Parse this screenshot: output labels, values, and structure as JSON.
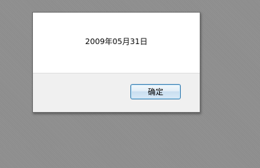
{
  "dialog": {
    "message": "2009年05月31日",
    "ok_label": "确定"
  }
}
